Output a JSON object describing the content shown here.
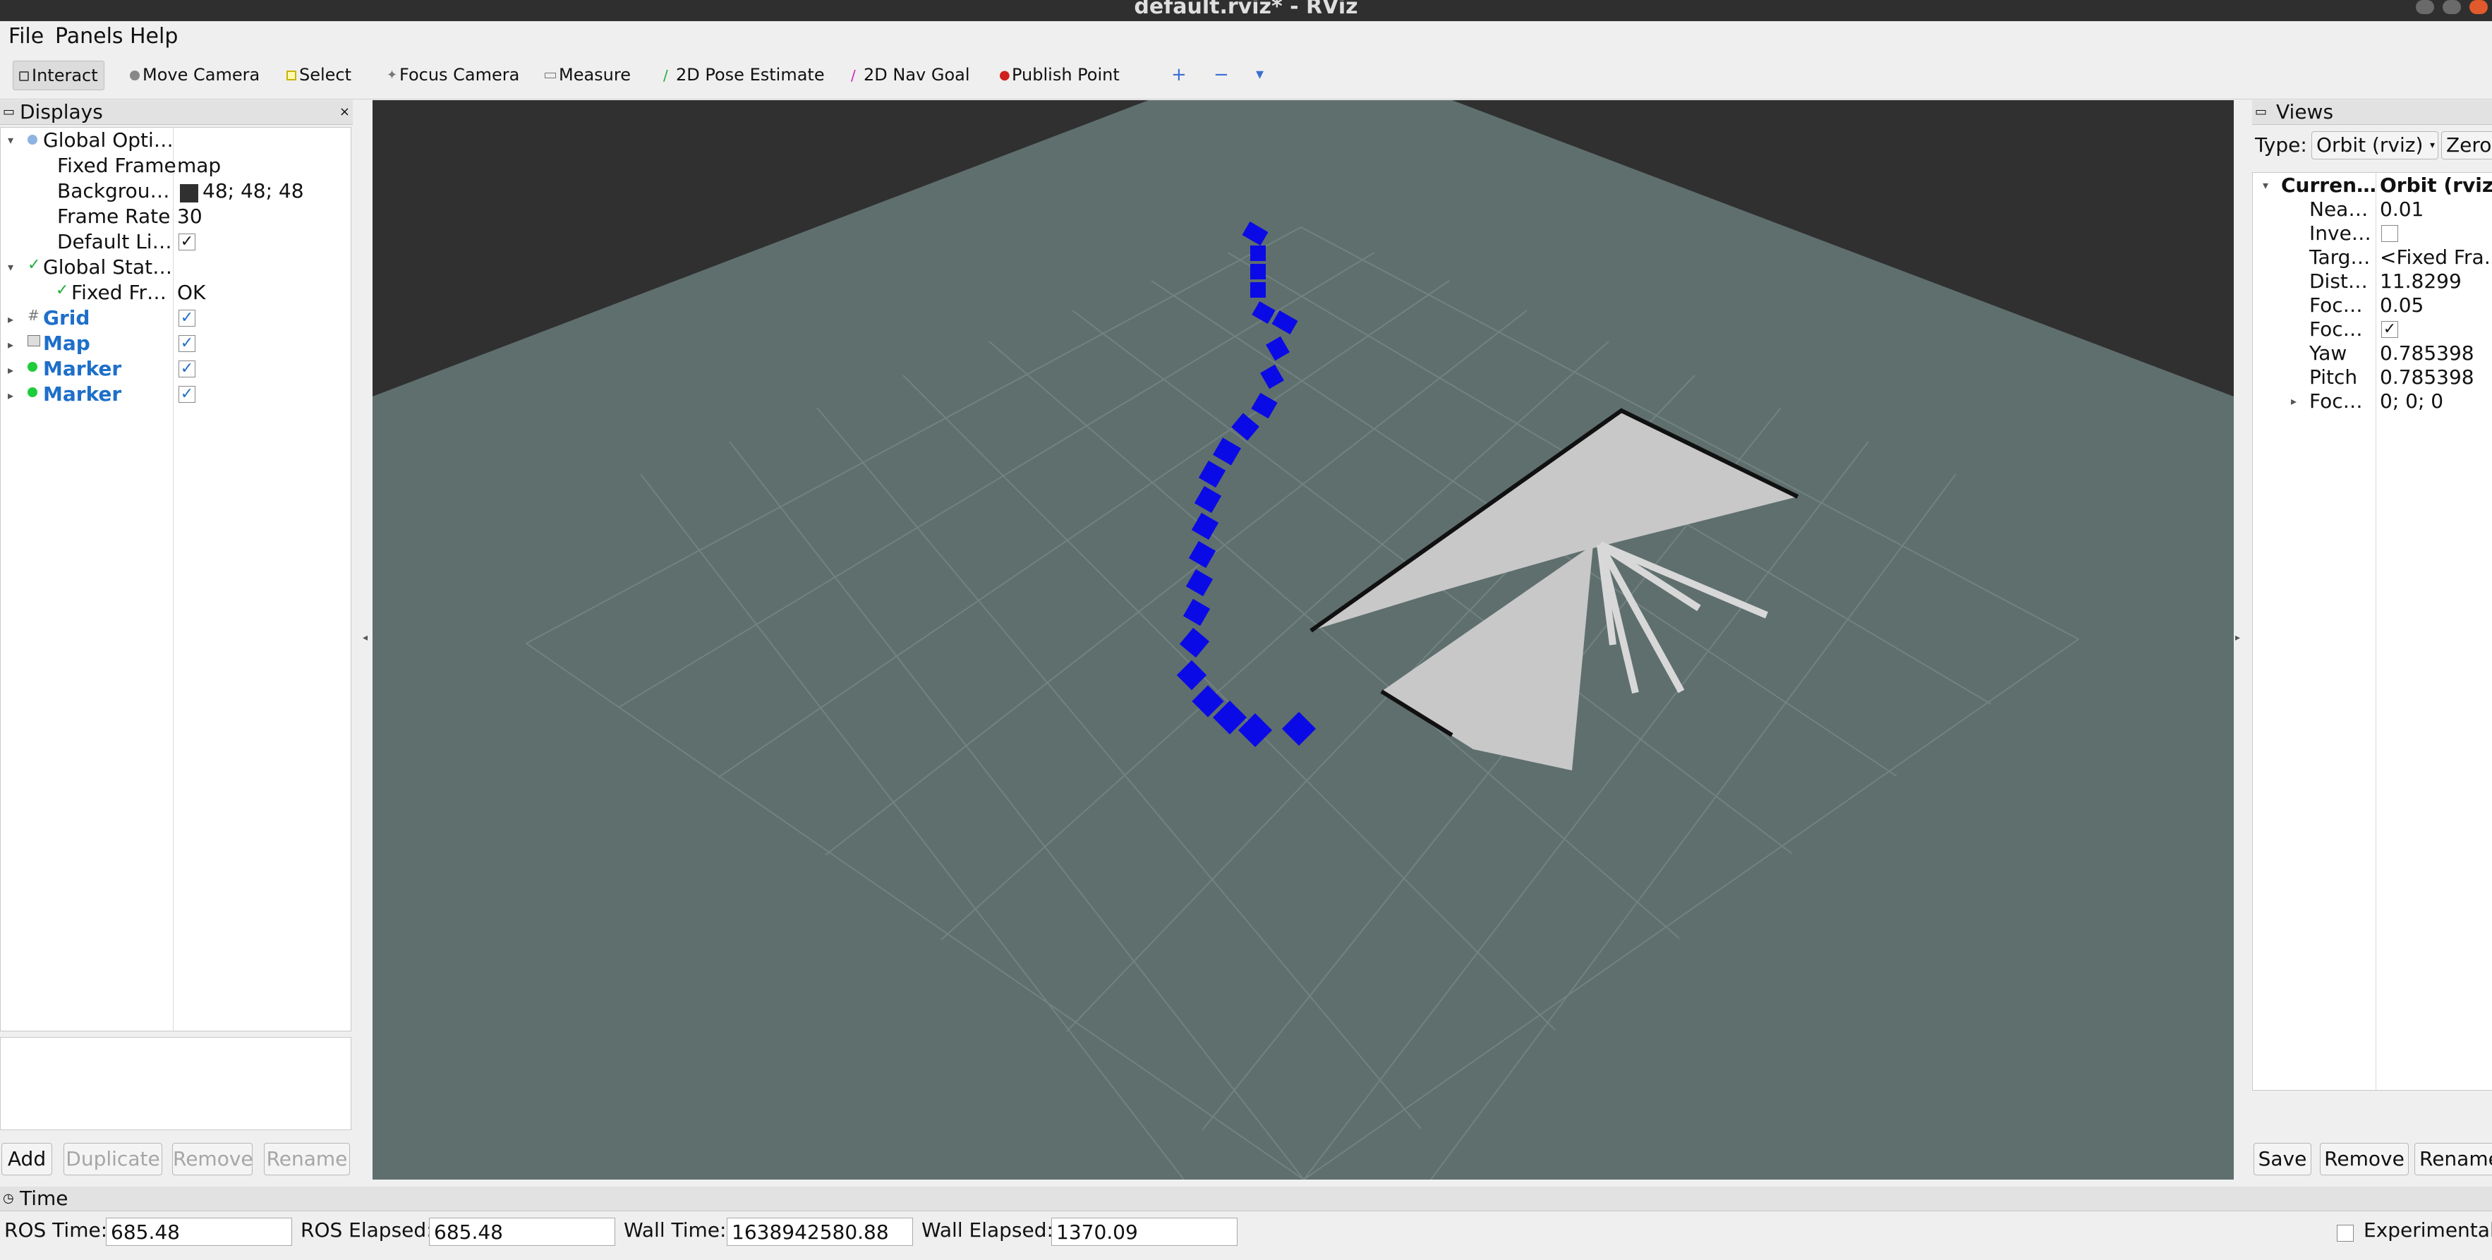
{
  "window": {
    "title": "default.rviz* - RViz"
  },
  "menu": [
    "File",
    "Panels",
    "Help"
  ],
  "toolbar": {
    "tools": [
      "Interact",
      "Move Camera",
      "Select",
      "Focus Camera",
      "Measure",
      "2D Pose Estimate",
      "2D Nav Goal",
      "Publish Point"
    ],
    "active": "Interact"
  },
  "displays": {
    "title": "Displays",
    "rows": [
      {
        "name": "Global Opti…",
        "value": ""
      },
      {
        "name": "Fixed Frame",
        "value": "map"
      },
      {
        "name": "Backgrou…",
        "value": "48; 48; 48"
      },
      {
        "name": "Frame Rate",
        "value": "30"
      },
      {
        "name": "Default Li…",
        "value": ""
      },
      {
        "name": "Global Stat…",
        "value": ""
      },
      {
        "name": "Fixed Fr…",
        "value": "OK"
      },
      {
        "name": "Grid",
        "value": ""
      },
      {
        "name": "Map",
        "value": ""
      },
      {
        "name": "Marker",
        "value": ""
      },
      {
        "name": "Marker",
        "value": ""
      }
    ],
    "buttons": {
      "add": "Add",
      "duplicate": "Duplicate",
      "remove": "Remove",
      "rename": "Rename"
    }
  },
  "views": {
    "title": "Views",
    "type_label": "Type:",
    "type_value": "Orbit (rviz)",
    "zero_label": "Zero",
    "rows": [
      {
        "name": "Curren…",
        "value": "Orbit (rviz)"
      },
      {
        "name": "Nea…",
        "value": "0.01"
      },
      {
        "name": "Inve…",
        "value": ""
      },
      {
        "name": "Targ…",
        "value": "<Fixed Fra…"
      },
      {
        "name": "Dist…",
        "value": "11.8299"
      },
      {
        "name": "Foc…",
        "value": "0.05"
      },
      {
        "name": "Foc…",
        "value": ""
      },
      {
        "name": "Yaw",
        "value": "0.785398"
      },
      {
        "name": "Pitch",
        "value": "0.785398"
      },
      {
        "name": "Foc…",
        "value": "0; 0; 0"
      }
    ],
    "buttons": {
      "save": "Save",
      "remove": "Remove",
      "rename": "Rename"
    }
  },
  "time": {
    "title": "Time",
    "ros_time_label": "ROS Time:",
    "ros_time": "685.48",
    "ros_elapsed_label": "ROS Elapsed:",
    "ros_elapsed": "685.48",
    "wall_time_label": "Wall Time:",
    "wall_time": "1638942580.88",
    "wall_elapsed_label": "Wall Elapsed:",
    "wall_elapsed": "1370.09",
    "experimental_label": "Experimental"
  },
  "colors": {
    "background": "#303030",
    "grid_plane": "#5f6f6e",
    "path_marker": "#0a0ae6",
    "map_free": "#c8c8c8"
  }
}
